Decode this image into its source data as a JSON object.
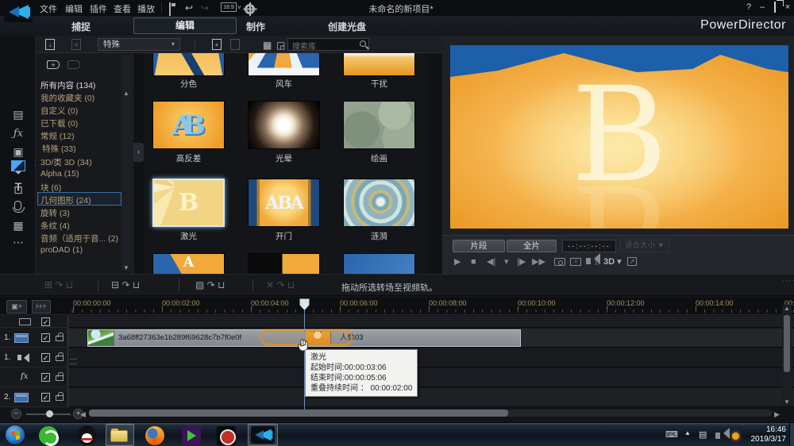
{
  "titlebar": {
    "menus": [
      "文件",
      "编辑",
      "插件",
      "查看",
      "播放"
    ],
    "icons": {
      "undo": "↩",
      "redo": "↪"
    },
    "ratio_label": "16:9",
    "title": "未命名的新项目*",
    "window": {
      "help": "?",
      "minimize": "–",
      "close": "×"
    }
  },
  "tabbar": {
    "tabs": [
      "捕捉",
      "编辑",
      "制作",
      "创建光盘"
    ],
    "active_tab_index": 1,
    "brand": "PowerDirector"
  },
  "rail": {
    "icons": [
      "media-room-icon",
      "effects-room-icon",
      "pip-objects-icon",
      "particle-room-icon",
      "title-room-icon",
      "transition-room-icon",
      "mixing-room-icon",
      "voice-record-icon",
      "chapter-room-icon",
      "subtitle-room-icon"
    ],
    "glyphs": [
      "▤",
      "ƒx",
      "▣",
      "◆",
      "T",
      "",
      "⊡",
      "",
      "▦",
      "⋯"
    ],
    "selected_index": 5
  },
  "library": {
    "toolbar": {
      "category_dropdown": "特殊",
      "search_placeholder": "搜索库"
    },
    "categories": [
      "所有内容 (134)",
      "我的收藏夹  (0)",
      "自定义  (0)",
      "已下载  (0)",
      "常规  (12)",
      "特殊  (33)",
      "3D/类 3D  (34)",
      "Alpha  (15)",
      "块  (6)",
      "几何图形  (24)",
      "旋转  (3)",
      "条纹  (4)",
      "音频（适用于音...  (2)",
      "proDAD  (1)"
    ],
    "selected_category_index": 5,
    "thumbs": {
      "labels": [
        "分色",
        "风车",
        "干扰",
        "高反差",
        "光晕",
        "绘画",
        "激光",
        "开门",
        "涟漪"
      ],
      "selected_label": "激光",
      "art": {
        "high_contrast": "AB",
        "door": "ABA",
        "laser": "B",
        "row4": "A"
      }
    }
  },
  "preview": {
    "letter": "B",
    "controls": {
      "clip": "片段",
      "movie": "全片",
      "timecode": "--:--:--:--",
      "fit": "适合大小 ▼",
      "threed": "3D ▾"
    },
    "transport": {
      "play": "▶",
      "stop": "■",
      "prev": "◀|",
      "step": "▾",
      "next": "|▶",
      "ff": "▶▶"
    }
  },
  "tl_toolbar": {
    "hint": "拖动所选转场至视频轨。",
    "arrow": "↷"
  },
  "timeline": {
    "ruler": [
      "00:00:00:00",
      "00:00:02:00",
      "00:00:04:00",
      "00:00:06:00",
      "00:00:08:00",
      "00:00:10:00",
      "00:00:12:00",
      "00:00:14:00",
      "00:"
    ],
    "tracks": {
      "video1_num": "1.",
      "audio1_num": "1.",
      "fx_label": "fx",
      "video2_num": "2."
    },
    "clips": {
      "clip1": "3a68ff27363e1b289f69628c7b7f0e0f",
      "clip2": "人像03"
    },
    "tooltip": {
      "title": "激光",
      "start": "起始时间:00:00:03:06",
      "end": "结束时间:00:00:05:06",
      "overlap": "重叠持续时间 ： 00:00:02:00"
    }
  },
  "taskbar": {
    "time": "16:46",
    "date": "2019/3/17"
  },
  "colors": {
    "accent_blue": "#3f8fd6",
    "selection_border": "#3a6ea5",
    "ruler_text": "#a8915f",
    "dropzone_orange": "#d89030",
    "preview_orange": "#f0a93a",
    "preview_sky": "#1d5fa8"
  }
}
